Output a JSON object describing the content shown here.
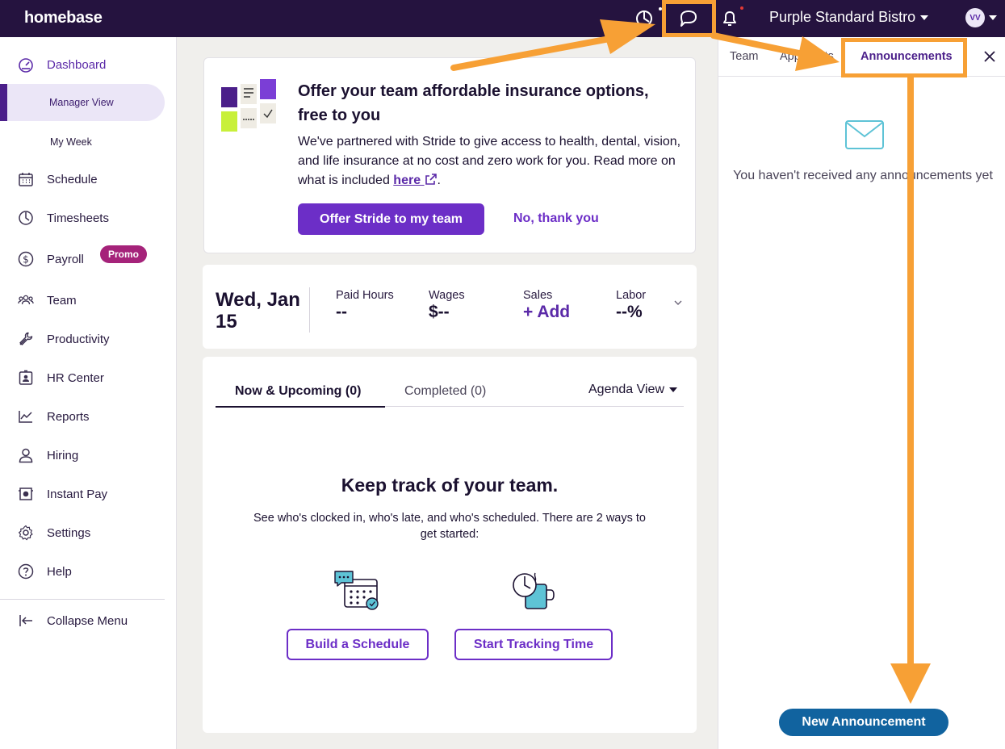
{
  "topbar": {
    "logo": "homebase",
    "org_name": "Purple Standard Bistro",
    "avatar_initials": "VV",
    "brand_bg": "#25133f"
  },
  "sidebar": {
    "items": [
      {
        "label": "Dashboard",
        "icon": "dashboard-gauge-icon"
      },
      {
        "label": "Manager View"
      },
      {
        "label": "My Week"
      },
      {
        "label": "Schedule",
        "icon": "calendar-icon"
      },
      {
        "label": "Timesheets",
        "icon": "clock-icon"
      },
      {
        "label": "Payroll",
        "icon": "dollar-icon",
        "badge": "Promo"
      },
      {
        "label": "Team",
        "icon": "team-icon"
      },
      {
        "label": "Productivity",
        "icon": "wrench-icon"
      },
      {
        "label": "HR Center",
        "icon": "id-badge-icon"
      },
      {
        "label": "Reports",
        "icon": "chart-line-icon"
      },
      {
        "label": "Hiring",
        "icon": "person-icon"
      },
      {
        "label": "Instant Pay",
        "icon": "instant-pay-icon"
      },
      {
        "label": "Settings",
        "icon": "gear-icon"
      },
      {
        "label": "Help",
        "icon": "help-icon"
      },
      {
        "label": "Collapse Menu",
        "icon": "collapse-icon"
      }
    ]
  },
  "insurance": {
    "title": "Offer your team affordable insurance options, free to you",
    "body": "We've partnered with Stride to give access to health, dental, vision, and life insurance at no cost and zero work for you. Read more on what is included",
    "link": "here",
    "body_end": ".",
    "primary_button": "Offer Stride to my team",
    "secondary_button": "No, thank you"
  },
  "stats": {
    "date": "Wed, Jan 15",
    "items": [
      {
        "label": "Paid Hours",
        "value": "--"
      },
      {
        "label": "Wages",
        "value": "$--"
      },
      {
        "label": "Sales",
        "value": "+ Add"
      },
      {
        "label": "Labor",
        "value": "--%"
      }
    ]
  },
  "agenda": {
    "tabs": [
      "Now & Upcoming (0)",
      "Completed (0)"
    ],
    "view_select": "Agenda View",
    "empty_title": "Keep track of your team.",
    "empty_body": "See who's clocked in, who's late, and who's scheduled. There are 2 ways to get started:",
    "buttons": [
      "Build a Schedule",
      "Start Tracking Time"
    ]
  },
  "panel": {
    "tabs": [
      "Team",
      "Applicants",
      "Announcements"
    ],
    "empty_text": "You haven't received any announcements yet",
    "new_button": "New Announcement",
    "accent": "#11639f"
  },
  "colors": {
    "purple": "#6c2ec7",
    "annotation_orange": "#f7a035"
  }
}
